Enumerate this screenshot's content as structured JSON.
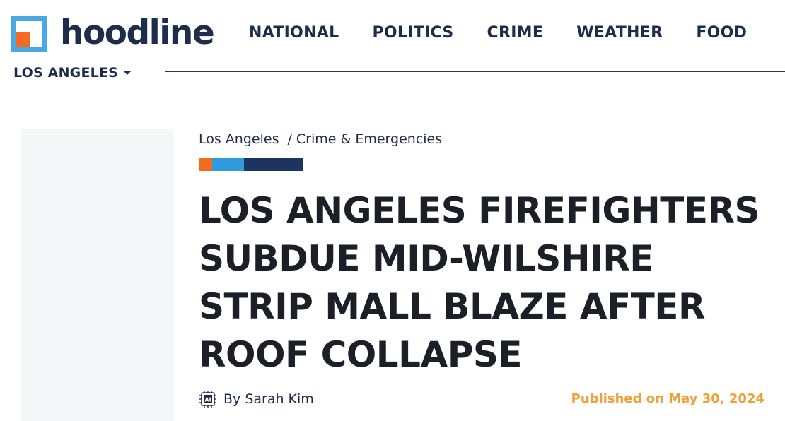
{
  "site": {
    "name": "hoodline",
    "colors": {
      "navy": "#1d2e4d",
      "orange": "#f26b21",
      "blue": "#2f9bdb",
      "date": "#f0a035"
    }
  },
  "nav": {
    "items": [
      "NATIONAL",
      "POLITICS",
      "CRIME",
      "WEATHER",
      "FOOD"
    ]
  },
  "city": {
    "label": "LOS ANGELES"
  },
  "breadcrumb": {
    "items": [
      "Los Angeles",
      "Crime & Emergencies"
    ],
    "separator": "/"
  },
  "article": {
    "headline": "LOS ANGELES FIREFIGHTERS SUBDUE MID-WILSHIRE STRIP MALL BLAZE AFTER ROOF COLLAPSE",
    "byline_icon": "ai-chip-icon",
    "byline_icon_text": "AI",
    "author": "By Sarah Kim",
    "published": "Published on May 30, 2024"
  }
}
